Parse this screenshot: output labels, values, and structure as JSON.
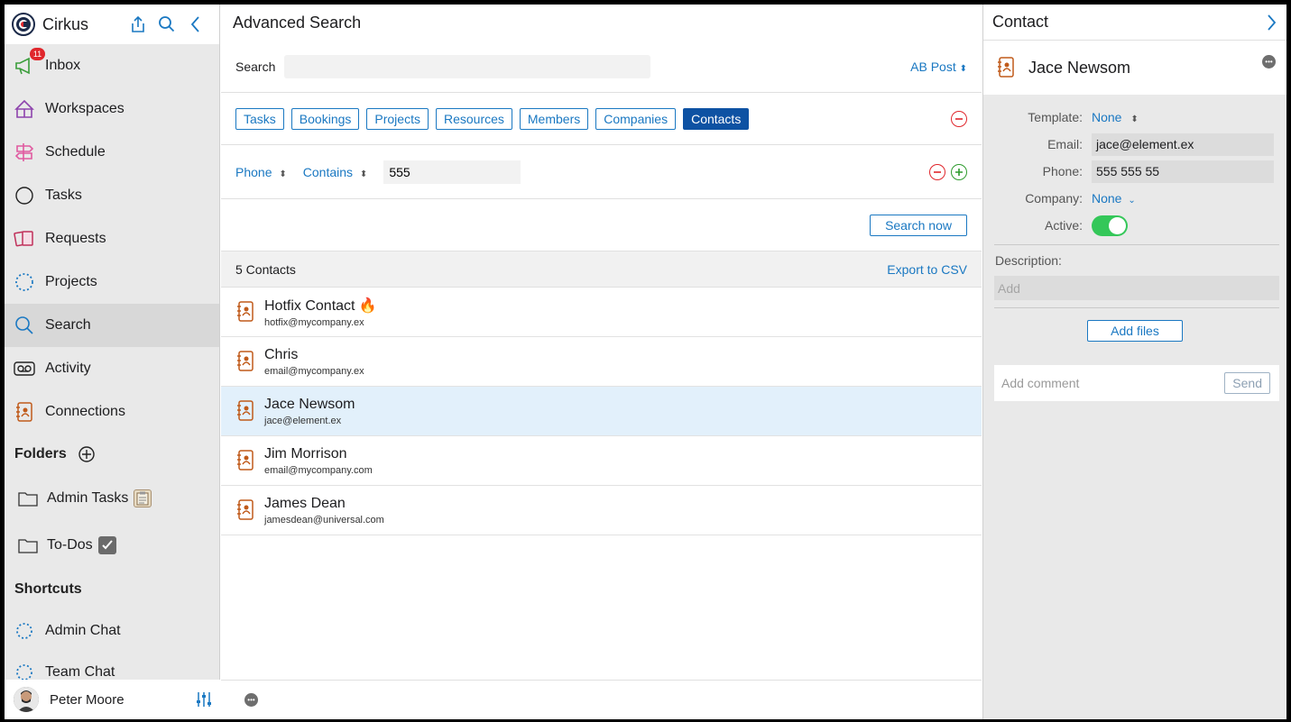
{
  "sidebar": {
    "app_name": "Cirkus",
    "inbox_badge": "11",
    "nav": [
      {
        "label": "Inbox",
        "icon": "megaphone-icon"
      },
      {
        "label": "Workspaces",
        "icon": "circus-tent-icon"
      },
      {
        "label": "Schedule",
        "icon": "signpost-icon"
      },
      {
        "label": "Tasks",
        "icon": "circle-icon"
      },
      {
        "label": "Requests",
        "icon": "cards-icon"
      },
      {
        "label": "Projects",
        "icon": "dotted-circle-icon"
      },
      {
        "label": "Search",
        "icon": "search-icon"
      },
      {
        "label": "Activity",
        "icon": "voicemail-icon"
      },
      {
        "label": "Connections",
        "icon": "contact-book-icon"
      }
    ],
    "folders_heading": "Folders",
    "folders": [
      {
        "label": "Admin Tasks",
        "emoji": "📋"
      },
      {
        "label": "To-Dos",
        "emoji": "✔"
      }
    ],
    "shortcuts_heading": "Shortcuts",
    "shortcuts": [
      {
        "label": "Admin Chat"
      },
      {
        "label": "Team Chat"
      }
    ],
    "user_name": "Peter Moore"
  },
  "search": {
    "title": "Advanced Search",
    "search_label": "Search",
    "search_value": "",
    "sort_label": "AB Post",
    "types": [
      "Tasks",
      "Bookings",
      "Projects",
      "Resources",
      "Members",
      "Companies",
      "Contacts"
    ],
    "active_type": "Contacts",
    "condition": {
      "field": "Phone",
      "operator": "Contains",
      "value": "555"
    },
    "search_button": "Search now",
    "results_count": "5 Contacts",
    "export_label": "Export to CSV",
    "results": [
      {
        "name": "Hotfix Contact 🔥",
        "email": "hotfix@mycompany.ex"
      },
      {
        "name": "Chris",
        "email": "email@mycompany.ex"
      },
      {
        "name": "Jace Newsom",
        "email": "jace@element.ex"
      },
      {
        "name": "Jim Morrison",
        "email": "email@mycompany.com"
      },
      {
        "name": "James Dean",
        "email": "jamesdean@universal.com"
      }
    ],
    "selected_index": 2
  },
  "contact": {
    "panel_title": "Contact",
    "name": "Jace Newsom",
    "template_label": "Template:",
    "template_value": "None",
    "email_label": "Email:",
    "email_value": "jace@element.ex",
    "phone_label": "Phone:",
    "phone_value": "555 555 55",
    "company_label": "Company:",
    "company_value": "None",
    "active_label": "Active:",
    "active": true,
    "description_label": "Description:",
    "description_placeholder": "Add",
    "add_files_label": "Add files",
    "comment_placeholder": "Add comment",
    "send_label": "Send"
  },
  "colors": {
    "accent": "#1a78c2",
    "active_chip": "#0e52a3",
    "selected_row": "#e2f0fb",
    "toggle_on": "#34c759",
    "badge": "#e0262c"
  }
}
